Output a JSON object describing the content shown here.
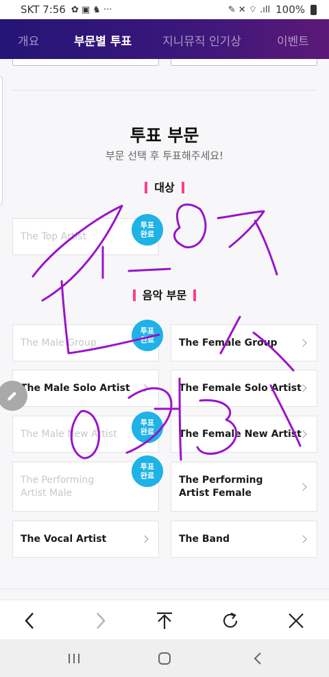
{
  "status_bar": {
    "carrier_time": "SKT 7:56",
    "left_icons": "✿ ▣ ♞ ···",
    "right_icons": "✎ ✕ ⌔ .ıll",
    "battery": "100%"
  },
  "nav_tabs": [
    "개요",
    "부문별 투표",
    "지니뮤직 인기상",
    "이벤트"
  ],
  "section": {
    "title": "투표 부문",
    "subtitle": "부문 선택 후 투표해주세요!"
  },
  "group_daesang": {
    "label": "대상"
  },
  "group_music": {
    "label": "음악 부문"
  },
  "badge": {
    "line1": "투표",
    "line2": "완료"
  },
  "categories": {
    "top_artist": {
      "label": "The Top Artist",
      "voted": true
    },
    "male_group": {
      "label": "The Male Group",
      "voted": true
    },
    "female_group": {
      "label": "The Female Group",
      "voted": false
    },
    "male_solo": {
      "label": "The Male Solo Artist",
      "voted": false
    },
    "female_solo": {
      "label": "The Female Solo Artist",
      "voted": false
    },
    "male_new": {
      "label": "The Male New Artist",
      "voted": true
    },
    "female_new": {
      "label": "The Female New Artist",
      "voted": false
    },
    "performing_male": {
      "line1": "The Performing",
      "line2": "Artist Male",
      "voted": true
    },
    "performing_female": {
      "line1": "The Performing",
      "line2": "Artist Female",
      "voted": false
    },
    "vocal": {
      "label": "The Vocal Artist",
      "voted": false
    },
    "band": {
      "label": "The Band",
      "voted": false
    }
  },
  "colors": {
    "nav_start": "#241576",
    "nav_end": "#5b1978",
    "badge": "#1fb2e6",
    "accent_bar": "#ff3d8b",
    "scribble": "#9b12c9"
  },
  "icons": {
    "browser_bar": [
      "back-icon",
      "forward-icon",
      "scroll-top-icon",
      "refresh-icon",
      "close-icon"
    ],
    "system_nav": [
      "recent-apps-icon",
      "home-icon",
      "system-back-icon"
    ],
    "floating": "pencil-icon"
  }
}
